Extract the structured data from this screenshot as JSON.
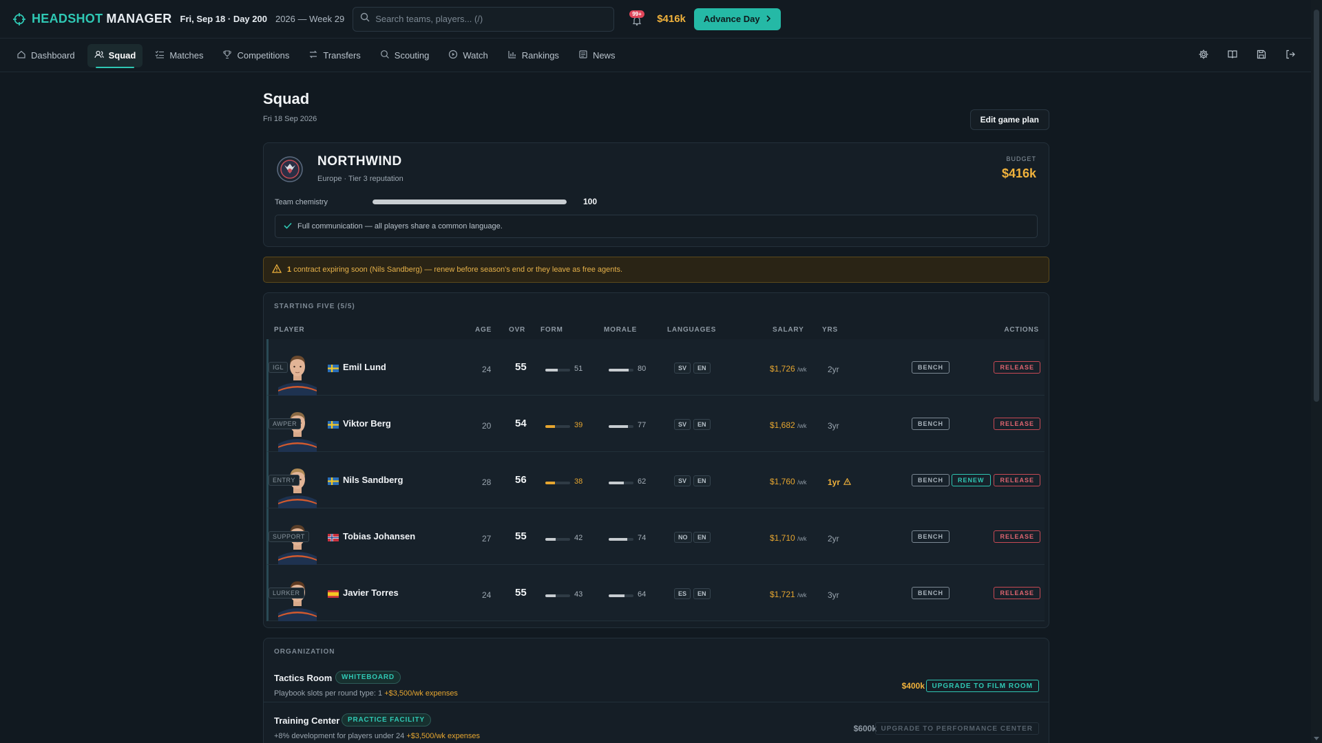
{
  "header": {
    "brand_accent": "HEADSHOT",
    "brand_rest": "MANAGER",
    "date": "Fri, Sep 18 · Day 200",
    "week": "2026 — Week 29",
    "search_placeholder": "Search teams, players... (/)",
    "notif_count": "99+",
    "budget": "$416k",
    "advance_label": "Advance Day"
  },
  "nav": {
    "items": [
      {
        "label": "Dashboard",
        "icon": "home-icon"
      },
      {
        "label": "Squad",
        "icon": "users-icon",
        "active": true
      },
      {
        "label": "Matches",
        "icon": "list-check-icon"
      },
      {
        "label": "Competitions",
        "icon": "trophy-icon"
      },
      {
        "label": "Transfers",
        "icon": "swap-icon"
      },
      {
        "label": "Scouting",
        "icon": "search-icon"
      },
      {
        "label": "Watch",
        "icon": "play-icon"
      },
      {
        "label": "Rankings",
        "icon": "bar-chart-icon"
      },
      {
        "label": "News",
        "icon": "newspaper-icon"
      }
    ],
    "right_icons": [
      "gear-icon",
      "book-icon",
      "save-icon",
      "logout-icon"
    ]
  },
  "page": {
    "title": "Squad",
    "date": "Fri 18 Sep 2026",
    "edit_plan_label": "Edit game plan"
  },
  "team": {
    "name": "NORTHWIND",
    "sub": "Europe · Tier 3 reputation",
    "budget_label": "BUDGET",
    "budget_value": "$416k",
    "chemistry_label": "Team chemistry",
    "chemistry_value": 100,
    "chemistry_text": "100",
    "communication": "Full communication — all players share a common language."
  },
  "warning": {
    "count": "1",
    "text": "contract expiring soon (Nils Sandberg) — renew before season's end or they leave as free agents."
  },
  "squad": {
    "section_label": "STARTING FIVE (5/5)",
    "headers": {
      "player": "PLAYER",
      "age": "AGE",
      "ovr": "OVR",
      "form": "FORM",
      "morale": "MORALE",
      "languages": "LANGUAGES",
      "salary": "SALARY",
      "yrs": "YRS",
      "actions": "ACTIONS"
    },
    "per_week": "/wk",
    "bench_label": "BENCH",
    "renew_label": "RENEW",
    "release_label": "RELEASE",
    "players": [
      {
        "name": "Emil Lund",
        "role": "IGL",
        "flag": "se",
        "age": "24",
        "ovr": "55",
        "form": 51,
        "form_text": "51",
        "form_low": false,
        "morale": 80,
        "morale_text": "80",
        "langs": [
          "SV",
          "EN"
        ],
        "salary": "$1,726",
        "yrs": "2yr",
        "expiring": false
      },
      {
        "name": "Viktor Berg",
        "role": "AWPER",
        "flag": "se",
        "age": "20",
        "ovr": "54",
        "form": 39,
        "form_text": "39",
        "form_low": true,
        "morale": 77,
        "morale_text": "77",
        "langs": [
          "SV",
          "EN"
        ],
        "salary": "$1,682",
        "yrs": "3yr",
        "expiring": false
      },
      {
        "name": "Nils Sandberg",
        "role": "ENTRY",
        "flag": "se",
        "age": "28",
        "ovr": "56",
        "form": 38,
        "form_text": "38",
        "form_low": true,
        "morale": 62,
        "morale_text": "62",
        "langs": [
          "SV",
          "EN"
        ],
        "salary": "$1,760",
        "yrs": "1yr",
        "expiring": true
      },
      {
        "name": "Tobias Johansen",
        "role": "SUPPORT",
        "flag": "no",
        "age": "27",
        "ovr": "55",
        "form": 42,
        "form_text": "42",
        "form_low": false,
        "morale": 74,
        "morale_text": "74",
        "langs": [
          "NO",
          "EN"
        ],
        "salary": "$1,710",
        "yrs": "2yr",
        "expiring": false
      },
      {
        "name": "Javier Torres",
        "role": "LURKER",
        "flag": "es",
        "age": "24",
        "ovr": "55",
        "form": 43,
        "form_text": "43",
        "form_low": false,
        "morale": 64,
        "morale_text": "64",
        "langs": [
          "ES",
          "EN"
        ],
        "salary": "$1,721",
        "yrs": "3yr",
        "expiring": false
      }
    ]
  },
  "organization": {
    "section_label": "ORGANIZATION",
    "facilities": [
      {
        "name": "Tactics Room",
        "badge": "WHITEBOARD",
        "desc": "Playbook slots per round type: 1",
        "expense": "+$3,500/wk expenses",
        "cost": "$400k",
        "upgrade": "UPGRADE TO FILM ROOM",
        "affordable": true
      },
      {
        "name": "Training Center",
        "badge": "PRACTICE FACILITY",
        "desc": "+8% development for players under 24",
        "expense": "+$3,500/wk expenses",
        "cost": "$600k",
        "upgrade": "UPGRADE TO PERFORMANCE CENTER",
        "affordable": false
      }
    ]
  },
  "colors": {
    "accent": "#2fc8b4",
    "gold": "#f0b23c",
    "danger": "#e06570",
    "background": "#111920"
  }
}
